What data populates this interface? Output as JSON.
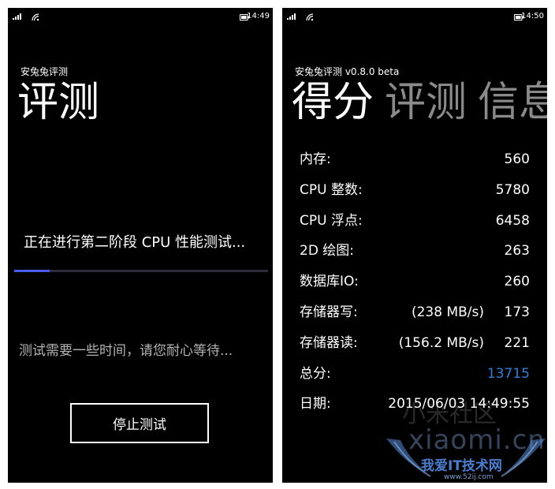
{
  "left_screen": {
    "status_bar": {
      "time": "14:49"
    },
    "app_title": "安兔兔评测",
    "page_title": "评测",
    "status_text": "正在进行第二阶段 CPU 性能测试...",
    "progress_fraction": 0.14,
    "hint_text": "测试需要一些时间，请您耐心等待...",
    "stop_button_label": "停止测试"
  },
  "right_screen": {
    "status_bar": {
      "time": "14:50"
    },
    "app_title": "安兔兔评测 v0.8.0 beta",
    "pivot_tabs": [
      {
        "label": "得分",
        "active": true
      },
      {
        "label": "评测",
        "active": false
      },
      {
        "label": "信息",
        "active": false
      }
    ],
    "scores": [
      {
        "label": "内存:",
        "rate": "",
        "value": "560"
      },
      {
        "label": "CPU 整数:",
        "rate": "",
        "value": "5780"
      },
      {
        "label": "CPU 浮点:",
        "rate": "",
        "value": "6458"
      },
      {
        "label": "2D 绘图:",
        "rate": "",
        "value": "263"
      },
      {
        "label": "数据库IO:",
        "rate": "",
        "value": "260"
      },
      {
        "label": "存储器写:",
        "rate": "(238 MB/s)",
        "value": "173"
      },
      {
        "label": "存储器读:",
        "rate": "(156.2 MB/s)",
        "value": "221"
      },
      {
        "label": "总分:",
        "rate": "",
        "value": "13715"
      },
      {
        "label": "日期:",
        "rate": "",
        "value": "2015/06/03 14:49:55"
      }
    ]
  },
  "watermark": {
    "chinese_text": "小米社区",
    "latin_text": "xiaomi.cn",
    "badge_text": "我爱IT技术网",
    "url_text": "www.52ij.com"
  },
  "colors": {
    "screen_bg": "#000000",
    "accent_progress": "#4a5cf0",
    "total_score": "#2f7fd8",
    "inactive_pivot": "#8a8a8a",
    "hint_text": "#b3b3b3"
  },
  "icons": [
    "signal-strength-icon",
    "wifi-icon",
    "battery-icon"
  ]
}
